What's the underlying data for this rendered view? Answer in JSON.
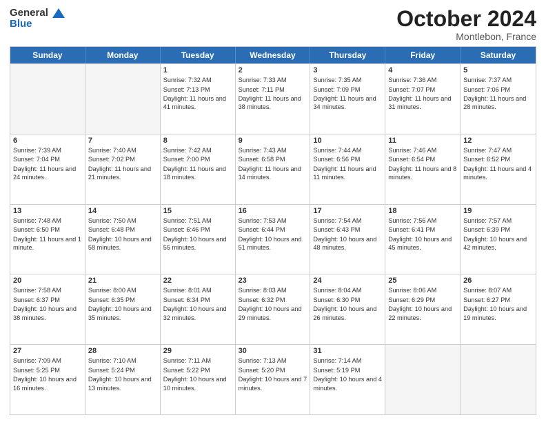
{
  "header": {
    "logo_line1": "General",
    "logo_line2": "Blue",
    "month": "October 2024",
    "location": "Montlebon, France"
  },
  "days_of_week": [
    "Sunday",
    "Monday",
    "Tuesday",
    "Wednesday",
    "Thursday",
    "Friday",
    "Saturday"
  ],
  "weeks": [
    [
      {
        "day": "",
        "empty": true
      },
      {
        "day": "",
        "empty": true
      },
      {
        "day": "1",
        "sunrise": "Sunrise: 7:32 AM",
        "sunset": "Sunset: 7:13 PM",
        "daylight": "Daylight: 11 hours and 41 minutes."
      },
      {
        "day": "2",
        "sunrise": "Sunrise: 7:33 AM",
        "sunset": "Sunset: 7:11 PM",
        "daylight": "Daylight: 11 hours and 38 minutes."
      },
      {
        "day": "3",
        "sunrise": "Sunrise: 7:35 AM",
        "sunset": "Sunset: 7:09 PM",
        "daylight": "Daylight: 11 hours and 34 minutes."
      },
      {
        "day": "4",
        "sunrise": "Sunrise: 7:36 AM",
        "sunset": "Sunset: 7:07 PM",
        "daylight": "Daylight: 11 hours and 31 minutes."
      },
      {
        "day": "5",
        "sunrise": "Sunrise: 7:37 AM",
        "sunset": "Sunset: 7:06 PM",
        "daylight": "Daylight: 11 hours and 28 minutes."
      }
    ],
    [
      {
        "day": "6",
        "sunrise": "Sunrise: 7:39 AM",
        "sunset": "Sunset: 7:04 PM",
        "daylight": "Daylight: 11 hours and 24 minutes."
      },
      {
        "day": "7",
        "sunrise": "Sunrise: 7:40 AM",
        "sunset": "Sunset: 7:02 PM",
        "daylight": "Daylight: 11 hours and 21 minutes."
      },
      {
        "day": "8",
        "sunrise": "Sunrise: 7:42 AM",
        "sunset": "Sunset: 7:00 PM",
        "daylight": "Daylight: 11 hours and 18 minutes."
      },
      {
        "day": "9",
        "sunrise": "Sunrise: 7:43 AM",
        "sunset": "Sunset: 6:58 PM",
        "daylight": "Daylight: 11 hours and 14 minutes."
      },
      {
        "day": "10",
        "sunrise": "Sunrise: 7:44 AM",
        "sunset": "Sunset: 6:56 PM",
        "daylight": "Daylight: 11 hours and 11 minutes."
      },
      {
        "day": "11",
        "sunrise": "Sunrise: 7:46 AM",
        "sunset": "Sunset: 6:54 PM",
        "daylight": "Daylight: 11 hours and 8 minutes."
      },
      {
        "day": "12",
        "sunrise": "Sunrise: 7:47 AM",
        "sunset": "Sunset: 6:52 PM",
        "daylight": "Daylight: 11 hours and 4 minutes."
      }
    ],
    [
      {
        "day": "13",
        "sunrise": "Sunrise: 7:48 AM",
        "sunset": "Sunset: 6:50 PM",
        "daylight": "Daylight: 11 hours and 1 minute."
      },
      {
        "day": "14",
        "sunrise": "Sunrise: 7:50 AM",
        "sunset": "Sunset: 6:48 PM",
        "daylight": "Daylight: 10 hours and 58 minutes."
      },
      {
        "day": "15",
        "sunrise": "Sunrise: 7:51 AM",
        "sunset": "Sunset: 6:46 PM",
        "daylight": "Daylight: 10 hours and 55 minutes."
      },
      {
        "day": "16",
        "sunrise": "Sunrise: 7:53 AM",
        "sunset": "Sunset: 6:44 PM",
        "daylight": "Daylight: 10 hours and 51 minutes."
      },
      {
        "day": "17",
        "sunrise": "Sunrise: 7:54 AM",
        "sunset": "Sunset: 6:43 PM",
        "daylight": "Daylight: 10 hours and 48 minutes."
      },
      {
        "day": "18",
        "sunrise": "Sunrise: 7:56 AM",
        "sunset": "Sunset: 6:41 PM",
        "daylight": "Daylight: 10 hours and 45 minutes."
      },
      {
        "day": "19",
        "sunrise": "Sunrise: 7:57 AM",
        "sunset": "Sunset: 6:39 PM",
        "daylight": "Daylight: 10 hours and 42 minutes."
      }
    ],
    [
      {
        "day": "20",
        "sunrise": "Sunrise: 7:58 AM",
        "sunset": "Sunset: 6:37 PM",
        "daylight": "Daylight: 10 hours and 38 minutes."
      },
      {
        "day": "21",
        "sunrise": "Sunrise: 8:00 AM",
        "sunset": "Sunset: 6:35 PM",
        "daylight": "Daylight: 10 hours and 35 minutes."
      },
      {
        "day": "22",
        "sunrise": "Sunrise: 8:01 AM",
        "sunset": "Sunset: 6:34 PM",
        "daylight": "Daylight: 10 hours and 32 minutes."
      },
      {
        "day": "23",
        "sunrise": "Sunrise: 8:03 AM",
        "sunset": "Sunset: 6:32 PM",
        "daylight": "Daylight: 10 hours and 29 minutes."
      },
      {
        "day": "24",
        "sunrise": "Sunrise: 8:04 AM",
        "sunset": "Sunset: 6:30 PM",
        "daylight": "Daylight: 10 hours and 26 minutes."
      },
      {
        "day": "25",
        "sunrise": "Sunrise: 8:06 AM",
        "sunset": "Sunset: 6:29 PM",
        "daylight": "Daylight: 10 hours and 22 minutes."
      },
      {
        "day": "26",
        "sunrise": "Sunrise: 8:07 AM",
        "sunset": "Sunset: 6:27 PM",
        "daylight": "Daylight: 10 hours and 19 minutes."
      }
    ],
    [
      {
        "day": "27",
        "sunrise": "Sunrise: 7:09 AM",
        "sunset": "Sunset: 5:25 PM",
        "daylight": "Daylight: 10 hours and 16 minutes."
      },
      {
        "day": "28",
        "sunrise": "Sunrise: 7:10 AM",
        "sunset": "Sunset: 5:24 PM",
        "daylight": "Daylight: 10 hours and 13 minutes."
      },
      {
        "day": "29",
        "sunrise": "Sunrise: 7:11 AM",
        "sunset": "Sunset: 5:22 PM",
        "daylight": "Daylight: 10 hours and 10 minutes."
      },
      {
        "day": "30",
        "sunrise": "Sunrise: 7:13 AM",
        "sunset": "Sunset: 5:20 PM",
        "daylight": "Daylight: 10 hours and 7 minutes."
      },
      {
        "day": "31",
        "sunrise": "Sunrise: 7:14 AM",
        "sunset": "Sunset: 5:19 PM",
        "daylight": "Daylight: 10 hours and 4 minutes."
      },
      {
        "day": "",
        "empty": true
      },
      {
        "day": "",
        "empty": true
      }
    ]
  ]
}
